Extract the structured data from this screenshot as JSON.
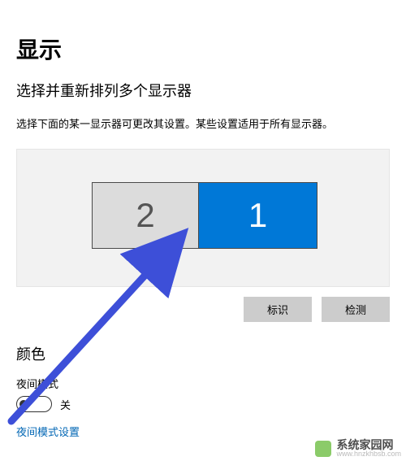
{
  "header": {
    "title": "显示",
    "subtitle": "选择并重新排列多个显示器",
    "description": "选择下面的某一显示器可更改其设置。某些设置适用于所有显示器。"
  },
  "monitors": {
    "secondary_label": "2",
    "primary_label": "1"
  },
  "actions": {
    "identify": "标识",
    "detect": "检测"
  },
  "color_section": {
    "header": "颜色",
    "night_light_label": "夜间模式",
    "toggle_state": "关",
    "settings_link": "夜间模式设置"
  },
  "watermark": {
    "cn": "系统家园网",
    "en": "www.hnzkhbsb.com"
  }
}
